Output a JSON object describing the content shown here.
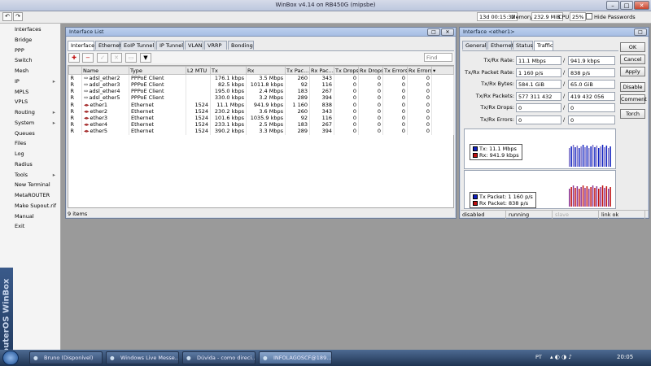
{
  "titlebar": {
    "title": "WinBox v4.14 on RB450G (mipsbe)"
  },
  "toolbar": {
    "undo_icon": "undo-icon",
    "redo_icon": "redo-icon",
    "uptime": "13d 00:15:32",
    "memory_label": "Memory",
    "memory_value": "232.9 MiB",
    "cpu_label": "CPU",
    "cpu_value": "25%",
    "hide_passwords_label": "Hide Passwords"
  },
  "sidebar": {
    "items": [
      "Interfaces",
      "Bridge",
      "PPP",
      "Switch",
      "Mesh",
      "IP",
      "MPLS",
      "VPLS",
      "Routing",
      "System",
      "Queues",
      "Files",
      "Log",
      "Radius",
      "Tools",
      "New Terminal",
      "MetaROUTER",
      "Make Supout.rif",
      "Manual",
      "Exit"
    ],
    "brand": "RouterOS WinBox"
  },
  "interface_list": {
    "title": "Interface List",
    "tabs": [
      "Interface",
      "Ethernet",
      "EoIP Tunnel",
      "IP Tunnel",
      "VLAN",
      "VRRP",
      "Bonding"
    ],
    "find_placeholder": "Find",
    "columns": [
      "Name",
      "Type",
      "L2 MTU",
      "Tx",
      "Rx",
      "Tx Pac...",
      "Rx Pac...",
      "Tx Drops",
      "Rx Drops",
      "Tx Errors",
      "Rx Errors"
    ],
    "rows": [
      {
        "flag": "R",
        "name": "adsl_ether2",
        "type": "PPPoE Client",
        "mtu": "",
        "tx": "176.1 kbps",
        "rx": "3.5 Mbps",
        "txp": "260",
        "rxp": "343",
        "txd": "0",
        "rxd": "0",
        "txe": "0",
        "rxe": "0"
      },
      {
        "flag": "R",
        "name": "adsl_ether3",
        "type": "PPPoE Client",
        "mtu": "",
        "tx": "82.5 kbps",
        "rx": "1011.8 kbps",
        "txp": "92",
        "rxp": "116",
        "txd": "0",
        "rxd": "0",
        "txe": "0",
        "rxe": "0"
      },
      {
        "flag": "R",
        "name": "adsl_ether4",
        "type": "PPPoE Client",
        "mtu": "",
        "tx": "195.0 kbps",
        "rx": "2.4 Mbps",
        "txp": "183",
        "rxp": "267",
        "txd": "0",
        "rxd": "0",
        "txe": "0",
        "rxe": "0"
      },
      {
        "flag": "R",
        "name": "adsl_ether5",
        "type": "PPPoE Client",
        "mtu": "",
        "tx": "330.0 kbps",
        "rx": "3.2 Mbps",
        "txp": "289",
        "rxp": "394",
        "txd": "0",
        "rxd": "0",
        "txe": "0",
        "rxe": "0"
      },
      {
        "flag": "R",
        "name": "ether1",
        "type": "Ethernet",
        "mtu": "1524",
        "tx": "11.1 Mbps",
        "rx": "941.9 kbps",
        "txp": "1 160",
        "rxp": "838",
        "txd": "0",
        "rxd": "0",
        "txe": "0",
        "rxe": "0"
      },
      {
        "flag": "R",
        "name": "ether2",
        "type": "Ethernet",
        "mtu": "1524",
        "tx": "230.2 kbps",
        "rx": "3.6 Mbps",
        "txp": "260",
        "rxp": "343",
        "txd": "0",
        "rxd": "0",
        "txe": "0",
        "rxe": "0"
      },
      {
        "flag": "R",
        "name": "ether3",
        "type": "Ethernet",
        "mtu": "1524",
        "tx": "101.6 kbps",
        "rx": "1035.9 kbps",
        "txp": "92",
        "rxp": "116",
        "txd": "0",
        "rxd": "0",
        "txe": "0",
        "rxe": "0"
      },
      {
        "flag": "R",
        "name": "ether4",
        "type": "Ethernet",
        "mtu": "1524",
        "tx": "233.1 kbps",
        "rx": "2.5 Mbps",
        "txp": "183",
        "rxp": "267",
        "txd": "0",
        "rxd": "0",
        "txe": "0",
        "rxe": "0"
      },
      {
        "flag": "R",
        "name": "ether5",
        "type": "Ethernet",
        "mtu": "1524",
        "tx": "390.2 kbps",
        "rx": "3.3 Mbps",
        "txp": "289",
        "rxp": "394",
        "txd": "0",
        "rxd": "0",
        "txe": "0",
        "rxe": "0"
      }
    ],
    "status": "9 items"
  },
  "interface_detail": {
    "title": "Interface <ether1>",
    "tabs": [
      "General",
      "Ethernet",
      "Status",
      "Traffic"
    ],
    "fields": [
      {
        "label": "Tx/Rx Rate:",
        "tx": "11.1 Mbps",
        "rx": "941.9 kbps"
      },
      {
        "label": "Tx/Rx Packet Rate:",
        "tx": "1 160 p/s",
        "rx": "838 p/s"
      },
      {
        "label": "Tx/Rx Bytes:",
        "tx": "584.1 GiB",
        "rx": "65.0 GiB"
      },
      {
        "label": "Tx/Rx Packets:",
        "tx": "577 311 432",
        "rx": "419 432 056"
      },
      {
        "label": "Tx/Rx Drops:",
        "tx": "0",
        "rx": "0"
      },
      {
        "label": "Tx/Rx Errors:",
        "tx": "0",
        "rx": "0"
      }
    ],
    "separator": "/",
    "graph1_legend": {
      "tx": "Tx:  11.1 Mbps",
      "rx": "Rx:  941.9 kbps"
    },
    "graph2_legend": {
      "tx": "Tx Packet:  1 160 p/s",
      "rx": "Rx Packet:  838 p/s"
    },
    "buttons": [
      "OK",
      "Cancel",
      "Apply",
      "Disable",
      "Comment",
      "Torch"
    ],
    "status": [
      "disabled",
      "running",
      "slave",
      "link ok"
    ],
    "colors": {
      "tx": "#1020c0",
      "rx": "#c01010"
    }
  },
  "taskbar": {
    "start_icon": "windows-start-icon",
    "tasks": [
      "Bruno (Disponível)",
      "Windows Live Messe...",
      "Dúvida - como direci...",
      "INFOLAGOSCF@189...."
    ],
    "lang": "PT",
    "clock": "20:05"
  }
}
